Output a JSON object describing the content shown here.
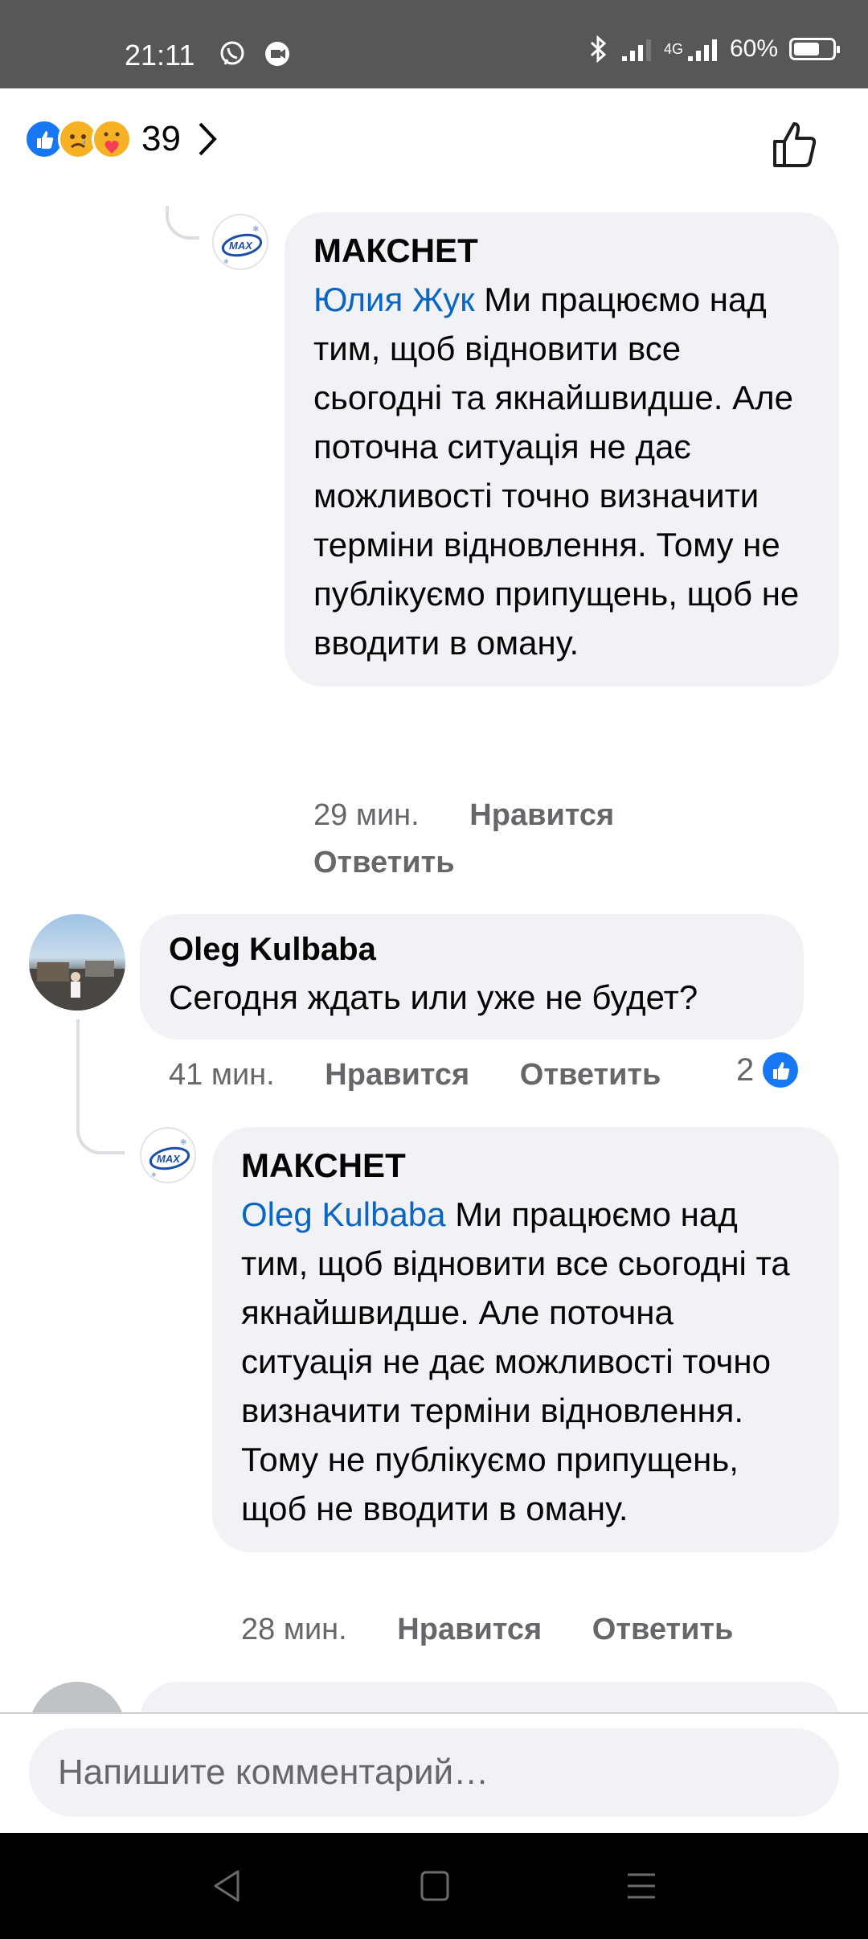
{
  "status_bar": {
    "time": "21:11",
    "network": "4G",
    "battery": "60%"
  },
  "header": {
    "reaction_count": "39",
    "reaction_icons": [
      "like-icon",
      "sad-icon",
      "care-icon"
    ]
  },
  "comments": [
    {
      "author": "МАКСНЕТ",
      "mention": "Юлия Жук",
      "text": " Ми працюємо над тим, щоб відновити все сьогодні та якнайшвидше. Але поточна ситуація не дає можливості точно визначити терміни відновлення. Тому не публікуємо припущень, щоб не вводити в оману.",
      "time": "29 мин.",
      "like_label": "Нравится",
      "reply_label": "Ответить"
    },
    {
      "author": "Oleg Kulbaba",
      "text": "Сегодня ждать или уже не будет?",
      "time": "41 мин.",
      "like_label": "Нравится",
      "reply_label": "Ответить",
      "likes": "2"
    },
    {
      "author": "МАКСНЕТ",
      "mention": "Oleg Kulbaba",
      "text": " Ми працюємо над тим, щоб відновити все сьогодні та якнайшвидше. Але поточна ситуація не дає можливості точно визначити терміни відновлення. Тому не публікуємо припущень, щоб не вводити в оману.",
      "time": "28 мин.",
      "like_label": "Нравится",
      "reply_label": "Ответить"
    }
  ],
  "composer": {
    "placeholder": "Напишите комментарий…"
  },
  "colors": {
    "accent": "#1877f2",
    "mention": "#0a66c2",
    "bubble": "#f0f2f5",
    "meta": "#65676b"
  }
}
